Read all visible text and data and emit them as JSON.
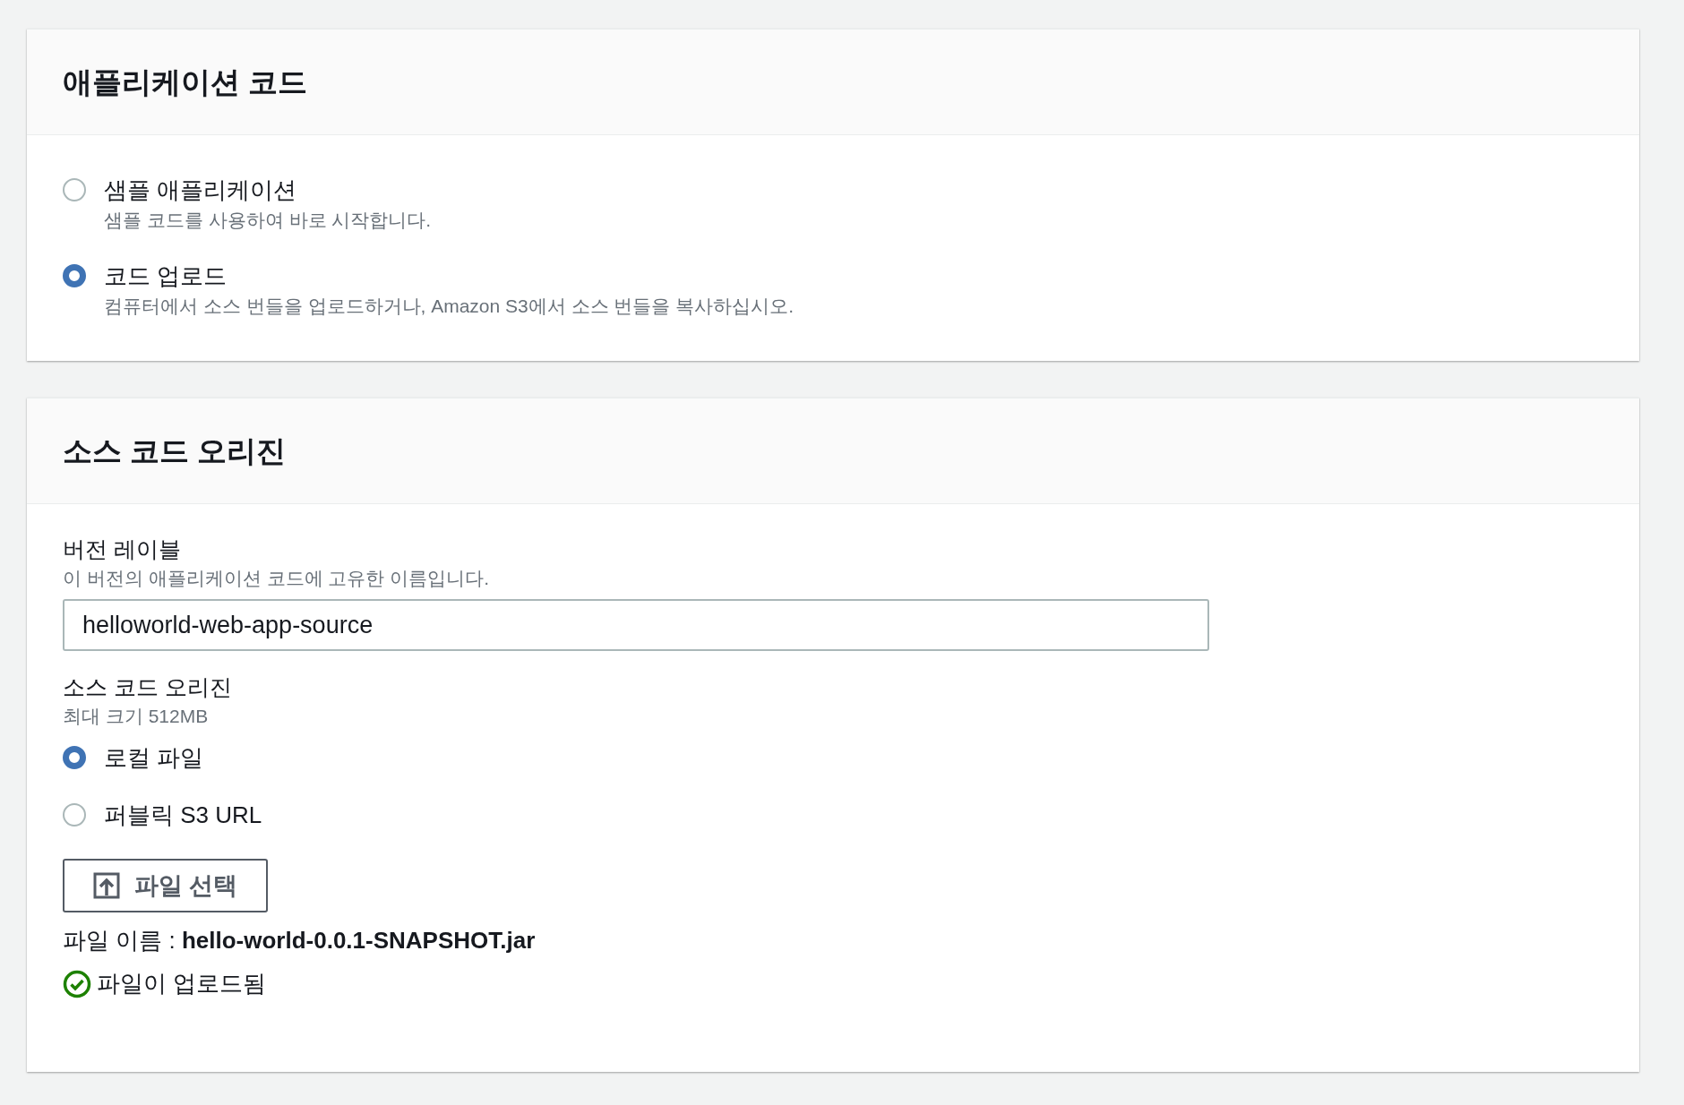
{
  "application_code": {
    "title": "애플리케이션 코드",
    "options": [
      {
        "label": "샘플 애플리케이션",
        "description": "샘플 코드를 사용하여 바로 시작합니다.",
        "selected": false
      },
      {
        "label": "코드 업로드",
        "description": "컴퓨터에서 소스 번들을 업로드하거나, Amazon S3에서 소스 번들을 복사하십시오.",
        "selected": true
      }
    ]
  },
  "source_code_origin": {
    "title": "소스 코드 오리진",
    "version_label": {
      "label": "버전 레이블",
      "hint": "이 버전의 애플리케이션 코드에 고유한 이름입니다.",
      "value": "helloworld-web-app-source"
    },
    "origin": {
      "label": "소스 코드 오리진",
      "hint": "최대 크기 512MB",
      "options": [
        {
          "label": "로컬 파일",
          "selected": true
        },
        {
          "label": "퍼블릭 S3 URL",
          "selected": false
        }
      ]
    },
    "file_button": {
      "label": "파일 선택"
    },
    "file_name": "파일 이름 : **hello-world-0.0.1-SNAPSHOT.jar**",
    "upload_status": "파일이 업로드됨"
  }
}
